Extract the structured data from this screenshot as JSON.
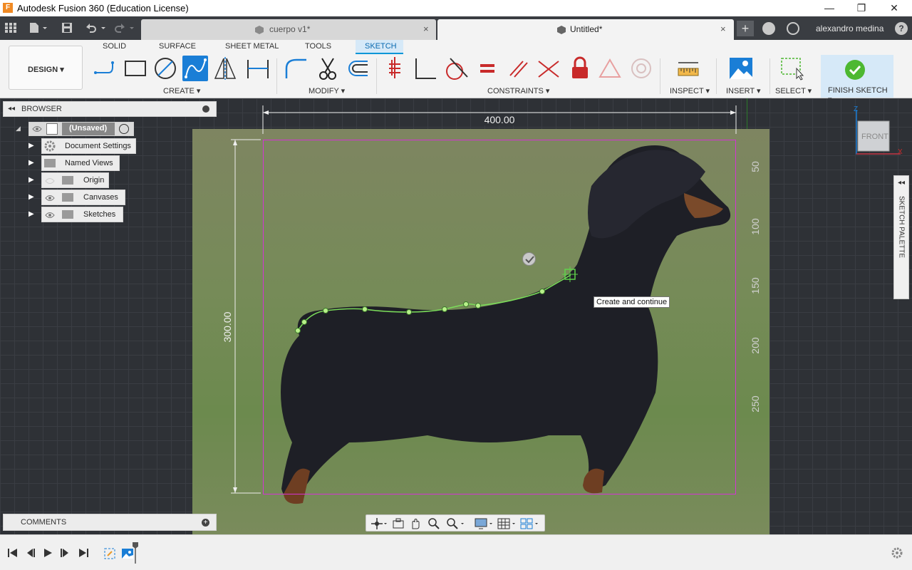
{
  "window": {
    "title": "Autodesk Fusion 360 (Education License)",
    "minimize": "—",
    "maximize": "❐",
    "close": "✕"
  },
  "tabs": [
    {
      "label": "cuerpo v1*",
      "close": "×"
    },
    {
      "label": "Untitled*",
      "close": "×"
    }
  ],
  "user": {
    "name": "alexandro medina"
  },
  "toolbar": {
    "workspace": "DESIGN ▾",
    "ws_tabs": [
      "SOLID",
      "SURFACE",
      "SHEET METAL",
      "TOOLS",
      "SKETCH"
    ],
    "active_tab": "SKETCH",
    "groups": {
      "create": "CREATE ▾",
      "modify": "MODIFY ▾",
      "constraints": "CONSTRAINTS ▾",
      "inspect": "INSPECT ▾",
      "insert": "INSERT ▾",
      "select": "SELECT ▾",
      "finish": "FINISH SKETCH ▾"
    }
  },
  "browser": {
    "title": "BROWSER",
    "root": "(Unsaved)",
    "items": [
      "Document Settings",
      "Named Views",
      "Origin",
      "Canvases",
      "Sketches"
    ]
  },
  "comments": {
    "title": "COMMENTS"
  },
  "dimensions": {
    "width": "400.00",
    "height": "300.00"
  },
  "ruler": [
    "50",
    "100",
    "150",
    "200",
    "250"
  ],
  "tooltip": "Create and continue",
  "viewcube": {
    "face": "FRONT",
    "axis_z": "Z",
    "axis_x": "X"
  },
  "sketch_palette": "SKETCH PALETTE",
  "colors": {
    "accent": "#0696d7",
    "sketch_frame": "#d433d4",
    "finish_green": "#4db831",
    "spline": "#7bdc5a"
  }
}
